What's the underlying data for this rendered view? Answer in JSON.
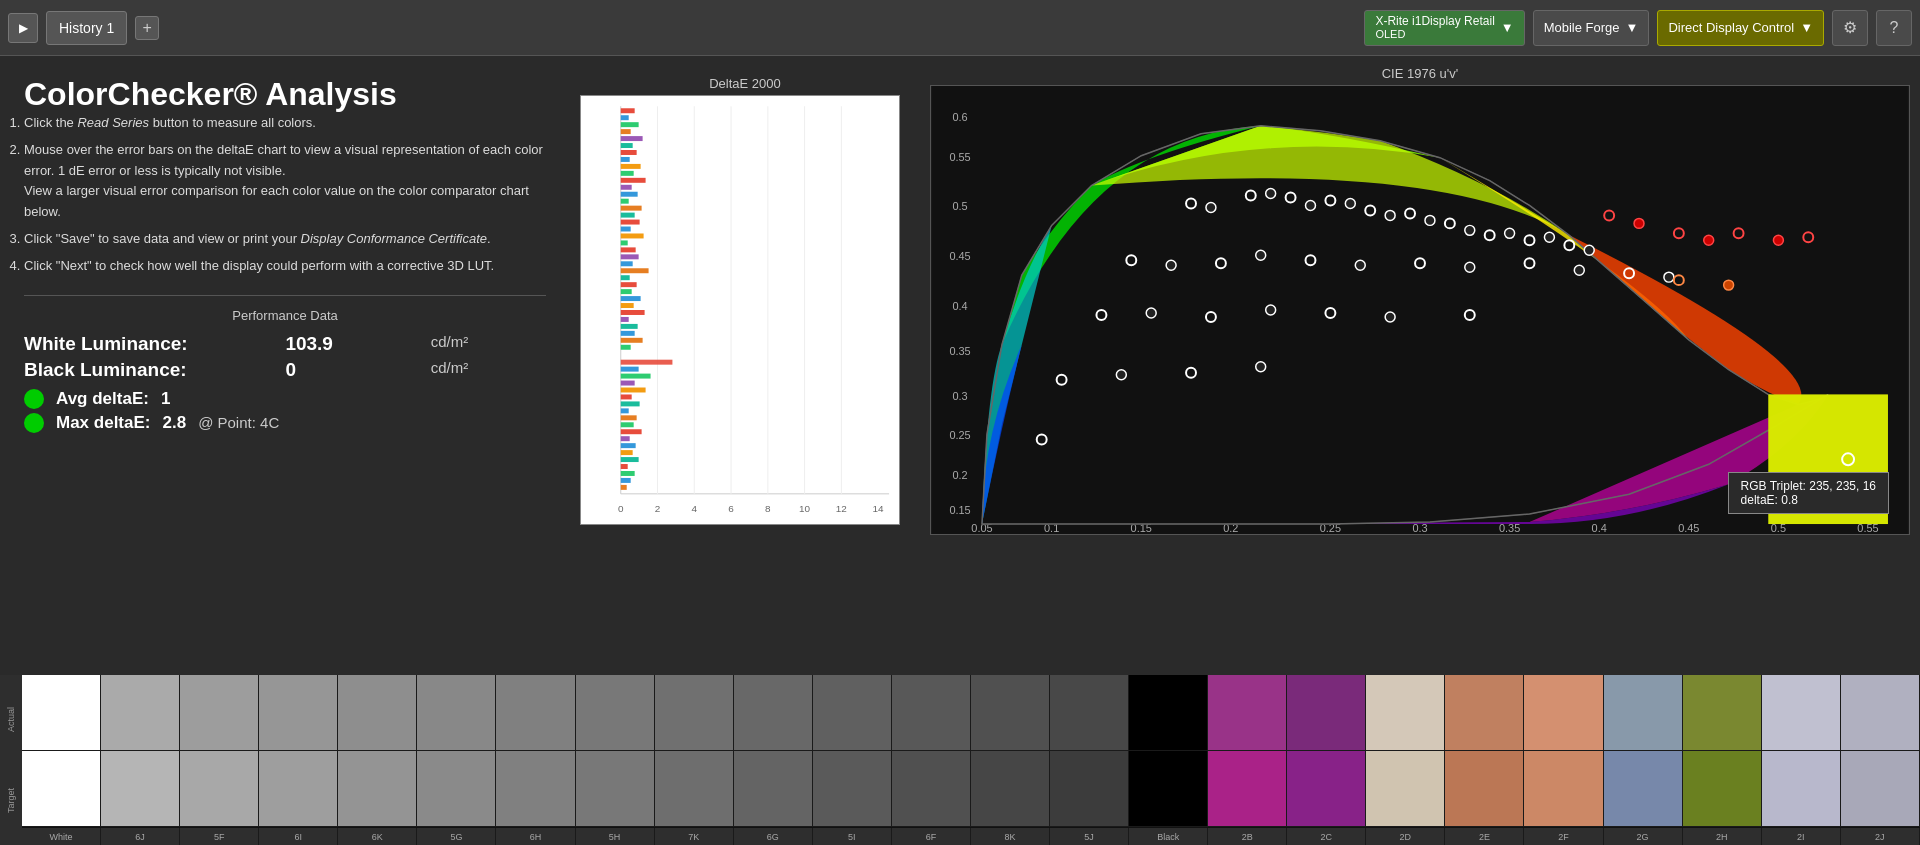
{
  "topbar": {
    "play_label": "▶",
    "tab_label": "History 1",
    "tab_plus": "+",
    "device1_label": "X-Rite i1Display Retail\nOLED",
    "device1_line1": "X-Rite i1Display Retail",
    "device1_line2": "OLED",
    "device2_label": "Mobile Forge",
    "device3_label": "Direct Display Control",
    "settings_icon": "⚙",
    "help_icon": "?"
  },
  "main": {
    "title": "ColorChecker® Analysis",
    "instructions": [
      "Click the Read Series button to measure all colors.",
      "Mouse over the error bars on the deltaE chart to view a visual representation of each color error. 1 dE error or less is typically not visible.\nView a larger visual error comparison for each color value on the color comparator chart below.",
      "Click \"Save\" to save data and view or print your Display Conformance Certificate.",
      "Click \"Next\" to check how well the display could perform with a corrective 3D LUT."
    ],
    "perf_label": "Performance Data",
    "white_lum_label": "White Luminance:",
    "white_lum_value": "103.9",
    "white_lum_unit": "cd/m²",
    "black_lum_label": "Black Luminance:",
    "black_lum_value": "0",
    "black_lum_unit": "cd/m²",
    "avg_delta_label": "Avg deltaE:",
    "avg_delta_value": "1",
    "max_delta_label": "Max deltaE:",
    "max_delta_value": "2.8",
    "max_delta_at": "@ Point: 4C",
    "chart_title": "DeltaE 2000",
    "cie_title": "CIE 1976 u'v'",
    "tooltip_rgb": "RGB Triplet: 235, 235, 16",
    "tooltip_delta": "deltaE: 0.8"
  },
  "swatches": {
    "names": [
      "White",
      "6J",
      "5F",
      "6I",
      "6K",
      "5G",
      "6H",
      "5H",
      "7K",
      "6G",
      "5I",
      "6F",
      "8K",
      "5J",
      "Black",
      "2B",
      "2C",
      "2D",
      "2E",
      "2F",
      "2G",
      "2H",
      "2I",
      "2J"
    ],
    "actual_colors": [
      "#ffffff",
      "#aaaaaa",
      "#9d9d9d",
      "#969696",
      "#8e8e8e",
      "#888888",
      "#808080",
      "#787878",
      "#707070",
      "#686868",
      "#606060",
      "#585858",
      "#505050",
      "#484848",
      "#000000",
      "#993388",
      "#7a2a7a",
      "#d4c8b8",
      "#c08060",
      "#d49070",
      "#8899aa",
      "#7a8830",
      "#c0c0d0",
      "#b0b0c0"
    ],
    "target_colors": [
      "#ffffff",
      "#b5b5b5",
      "#a8a8a8",
      "#9e9e9e",
      "#949494",
      "#8a8a8a",
      "#808080",
      "#787878",
      "#6e6e6e",
      "#646464",
      "#5a5a5a",
      "#505050",
      "#464646",
      "#3c3c3c",
      "#000000",
      "#aa2288",
      "#882288",
      "#d0c4b0",
      "#bb7755",
      "#cc8866",
      "#7788aa",
      "#6a8020",
      "#b8b8cc",
      "#a8a8b8"
    ]
  }
}
